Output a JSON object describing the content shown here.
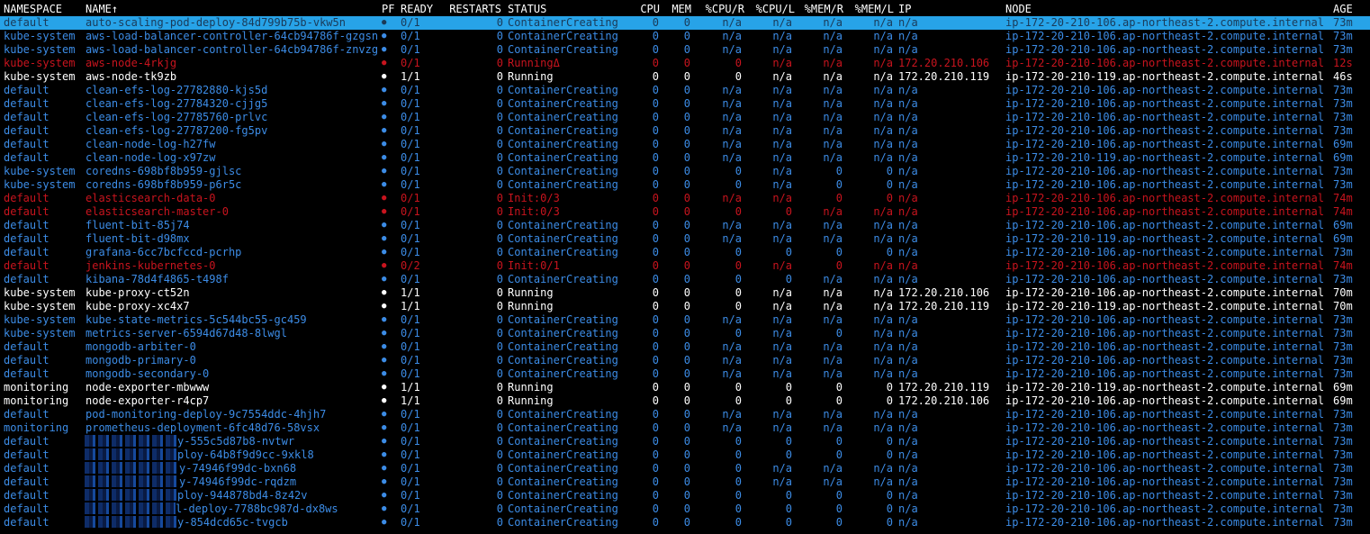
{
  "colors": {
    "running": "#ffffff",
    "pending": "#3c8ce6",
    "error": "#c8141e",
    "selected_bg": "#27a3e8",
    "background": "#000000"
  },
  "header": {
    "namespace": "NAMESPACE",
    "name": "NAME↑",
    "pf": "PF",
    "ready": "READY",
    "restarts": "RESTARTS",
    "status": "STATUS",
    "cpu": "CPU",
    "mem": "MEM",
    "cpu_r": "%CPU/R",
    "cpu_l": "%CPU/L",
    "mem_r": "%MEM/R",
    "mem_l": "%MEM/L",
    "ip": "IP",
    "node": "NODE",
    "age": "AGE"
  },
  "rows": [
    {
      "state": "selected",
      "masked": false,
      "namespace": "default",
      "name": "auto-scaling-pod-deploy-84d799b75b-vkw5n",
      "pf": "●",
      "ready": "0/1",
      "restarts": "0",
      "status": "ContainerCreating",
      "cpu": "0",
      "mem": "0",
      "cpu_r": "n/a",
      "cpu_l": "n/a",
      "mem_r": "n/a",
      "mem_l": "n/a",
      "ip": "n/a",
      "node": "ip-172-20-210-106.ap-northeast-2.compute.internal",
      "age": "73m"
    },
    {
      "state": "pending",
      "masked": false,
      "namespace": "kube-system",
      "name": "aws-load-balancer-controller-64cb94786f-gzgsn",
      "pf": "●",
      "ready": "0/1",
      "restarts": "0",
      "status": "ContainerCreating",
      "cpu": "0",
      "mem": "0",
      "cpu_r": "n/a",
      "cpu_l": "n/a",
      "mem_r": "n/a",
      "mem_l": "n/a",
      "ip": "n/a",
      "node": "ip-172-20-210-106.ap-northeast-2.compute.internal",
      "age": "73m"
    },
    {
      "state": "pending",
      "masked": false,
      "namespace": "kube-system",
      "name": "aws-load-balancer-controller-64cb94786f-znvzg",
      "pf": "●",
      "ready": "0/1",
      "restarts": "0",
      "status": "ContainerCreating",
      "cpu": "0",
      "mem": "0",
      "cpu_r": "n/a",
      "cpu_l": "n/a",
      "mem_r": "n/a",
      "mem_l": "n/a",
      "ip": "n/a",
      "node": "ip-172-20-210-106.ap-northeast-2.compute.internal",
      "age": "73m"
    },
    {
      "state": "error",
      "masked": false,
      "namespace": "kube-system",
      "name": "aws-node-4rkjg",
      "pf": "●",
      "ready": "0/1",
      "restarts": "0",
      "status": "RunningΔ",
      "cpu": "0",
      "mem": "0",
      "cpu_r": "0",
      "cpu_l": "n/a",
      "mem_r": "n/a",
      "mem_l": "n/a",
      "ip": "172.20.210.106",
      "node": "ip-172-20-210-106.ap-northeast-2.compute.internal",
      "age": "12s"
    },
    {
      "state": "running",
      "masked": false,
      "namespace": "kube-system",
      "name": "aws-node-tk9zb",
      "pf": "●",
      "ready": "1/1",
      "restarts": "0",
      "status": "Running",
      "cpu": "0",
      "mem": "0",
      "cpu_r": "0",
      "cpu_l": "n/a",
      "mem_r": "n/a",
      "mem_l": "n/a",
      "ip": "172.20.210.119",
      "node": "ip-172-20-210-119.ap-northeast-2.compute.internal",
      "age": "46s"
    },
    {
      "state": "pending",
      "masked": false,
      "namespace": "default",
      "name": "clean-efs-log-27782880-kjs5d",
      "pf": "●",
      "ready": "0/1",
      "restarts": "0",
      "status": "ContainerCreating",
      "cpu": "0",
      "mem": "0",
      "cpu_r": "n/a",
      "cpu_l": "n/a",
      "mem_r": "n/a",
      "mem_l": "n/a",
      "ip": "n/a",
      "node": "ip-172-20-210-106.ap-northeast-2.compute.internal",
      "age": "73m"
    },
    {
      "state": "pending",
      "masked": false,
      "namespace": "default",
      "name": "clean-efs-log-27784320-cjjg5",
      "pf": "●",
      "ready": "0/1",
      "restarts": "0",
      "status": "ContainerCreating",
      "cpu": "0",
      "mem": "0",
      "cpu_r": "n/a",
      "cpu_l": "n/a",
      "mem_r": "n/a",
      "mem_l": "n/a",
      "ip": "n/a",
      "node": "ip-172-20-210-106.ap-northeast-2.compute.internal",
      "age": "73m"
    },
    {
      "state": "pending",
      "masked": false,
      "namespace": "default",
      "name": "clean-efs-log-27785760-prlvc",
      "pf": "●",
      "ready": "0/1",
      "restarts": "0",
      "status": "ContainerCreating",
      "cpu": "0",
      "mem": "0",
      "cpu_r": "n/a",
      "cpu_l": "n/a",
      "mem_r": "n/a",
      "mem_l": "n/a",
      "ip": "n/a",
      "node": "ip-172-20-210-106.ap-northeast-2.compute.internal",
      "age": "73m"
    },
    {
      "state": "pending",
      "masked": false,
      "namespace": "default",
      "name": "clean-efs-log-27787200-fg5pv",
      "pf": "●",
      "ready": "0/1",
      "restarts": "0",
      "status": "ContainerCreating",
      "cpu": "0",
      "mem": "0",
      "cpu_r": "n/a",
      "cpu_l": "n/a",
      "mem_r": "n/a",
      "mem_l": "n/a",
      "ip": "n/a",
      "node": "ip-172-20-210-106.ap-northeast-2.compute.internal",
      "age": "73m"
    },
    {
      "state": "pending",
      "masked": false,
      "namespace": "default",
      "name": "clean-node-log-h27fw",
      "pf": "●",
      "ready": "0/1",
      "restarts": "0",
      "status": "ContainerCreating",
      "cpu": "0",
      "mem": "0",
      "cpu_r": "n/a",
      "cpu_l": "n/a",
      "mem_r": "n/a",
      "mem_l": "n/a",
      "ip": "n/a",
      "node": "ip-172-20-210-106.ap-northeast-2.compute.internal",
      "age": "69m"
    },
    {
      "state": "pending",
      "masked": false,
      "namespace": "default",
      "name": "clean-node-log-x97zw",
      "pf": "●",
      "ready": "0/1",
      "restarts": "0",
      "status": "ContainerCreating",
      "cpu": "0",
      "mem": "0",
      "cpu_r": "n/a",
      "cpu_l": "n/a",
      "mem_r": "n/a",
      "mem_l": "n/a",
      "ip": "n/a",
      "node": "ip-172-20-210-119.ap-northeast-2.compute.internal",
      "age": "69m"
    },
    {
      "state": "pending",
      "masked": false,
      "namespace": "kube-system",
      "name": "coredns-698bf8b959-gjlsc",
      "pf": "●",
      "ready": "0/1",
      "restarts": "0",
      "status": "ContainerCreating",
      "cpu": "0",
      "mem": "0",
      "cpu_r": "0",
      "cpu_l": "n/a",
      "mem_r": "0",
      "mem_l": "0",
      "ip": "n/a",
      "node": "ip-172-20-210-106.ap-northeast-2.compute.internal",
      "age": "73m"
    },
    {
      "state": "pending",
      "masked": false,
      "namespace": "kube-system",
      "name": "coredns-698bf8b959-p6r5c",
      "pf": "●",
      "ready": "0/1",
      "restarts": "0",
      "status": "ContainerCreating",
      "cpu": "0",
      "mem": "0",
      "cpu_r": "0",
      "cpu_l": "n/a",
      "mem_r": "0",
      "mem_l": "0",
      "ip": "n/a",
      "node": "ip-172-20-210-106.ap-northeast-2.compute.internal",
      "age": "73m"
    },
    {
      "state": "error",
      "masked": false,
      "namespace": "default",
      "name": "elasticsearch-data-0",
      "pf": "●",
      "ready": "0/1",
      "restarts": "0",
      "status": "Init:0/3",
      "cpu": "0",
      "mem": "0",
      "cpu_r": "n/a",
      "cpu_l": "n/a",
      "mem_r": "0",
      "mem_l": "0",
      "ip": "n/a",
      "node": "ip-172-20-210-106.ap-northeast-2.compute.internal",
      "age": "74m"
    },
    {
      "state": "error",
      "masked": false,
      "namespace": "default",
      "name": "elasticsearch-master-0",
      "pf": "●",
      "ready": "0/1",
      "restarts": "0",
      "status": "Init:0/3",
      "cpu": "0",
      "mem": "0",
      "cpu_r": "0",
      "cpu_l": "0",
      "mem_r": "n/a",
      "mem_l": "n/a",
      "ip": "n/a",
      "node": "ip-172-20-210-106.ap-northeast-2.compute.internal",
      "age": "74m"
    },
    {
      "state": "pending",
      "masked": false,
      "namespace": "default",
      "name": "fluent-bit-85j74",
      "pf": "●",
      "ready": "0/1",
      "restarts": "0",
      "status": "ContainerCreating",
      "cpu": "0",
      "mem": "0",
      "cpu_r": "n/a",
      "cpu_l": "n/a",
      "mem_r": "n/a",
      "mem_l": "n/a",
      "ip": "n/a",
      "node": "ip-172-20-210-106.ap-northeast-2.compute.internal",
      "age": "69m"
    },
    {
      "state": "pending",
      "masked": false,
      "namespace": "default",
      "name": "fluent-bit-d98mx",
      "pf": "●",
      "ready": "0/1",
      "restarts": "0",
      "status": "ContainerCreating",
      "cpu": "0",
      "mem": "0",
      "cpu_r": "n/a",
      "cpu_l": "n/a",
      "mem_r": "n/a",
      "mem_l": "n/a",
      "ip": "n/a",
      "node": "ip-172-20-210-119.ap-northeast-2.compute.internal",
      "age": "69m"
    },
    {
      "state": "pending",
      "masked": false,
      "namespace": "default",
      "name": "grafana-6cc7bcfccd-pcrhp",
      "pf": "●",
      "ready": "0/1",
      "restarts": "0",
      "status": "ContainerCreating",
      "cpu": "0",
      "mem": "0",
      "cpu_r": "0",
      "cpu_l": "0",
      "mem_r": "0",
      "mem_l": "0",
      "ip": "n/a",
      "node": "ip-172-20-210-106.ap-northeast-2.compute.internal",
      "age": "73m"
    },
    {
      "state": "error",
      "masked": false,
      "namespace": "default",
      "name": "jenkins-kubernetes-0",
      "pf": "●",
      "ready": "0/2",
      "restarts": "0",
      "status": "Init:0/1",
      "cpu": "0",
      "mem": "0",
      "cpu_r": "0",
      "cpu_l": "n/a",
      "mem_r": "0",
      "mem_l": "n/a",
      "ip": "n/a",
      "node": "ip-172-20-210-106.ap-northeast-2.compute.internal",
      "age": "74m"
    },
    {
      "state": "pending",
      "masked": false,
      "namespace": "default",
      "name": "kibana-78d4f4865-t498f",
      "pf": "●",
      "ready": "0/1",
      "restarts": "0",
      "status": "ContainerCreating",
      "cpu": "0",
      "mem": "0",
      "cpu_r": "0",
      "cpu_l": "0",
      "mem_r": "n/a",
      "mem_l": "n/a",
      "ip": "n/a",
      "node": "ip-172-20-210-106.ap-northeast-2.compute.internal",
      "age": "73m"
    },
    {
      "state": "running",
      "masked": false,
      "namespace": "kube-system",
      "name": "kube-proxy-ct52n",
      "pf": "●",
      "ready": "1/1",
      "restarts": "0",
      "status": "Running",
      "cpu": "0",
      "mem": "0",
      "cpu_r": "0",
      "cpu_l": "n/a",
      "mem_r": "n/a",
      "mem_l": "n/a",
      "ip": "172.20.210.106",
      "node": "ip-172-20-210-106.ap-northeast-2.compute.internal",
      "age": "70m"
    },
    {
      "state": "running",
      "masked": false,
      "namespace": "kube-system",
      "name": "kube-proxy-xc4x7",
      "pf": "●",
      "ready": "1/1",
      "restarts": "0",
      "status": "Running",
      "cpu": "0",
      "mem": "0",
      "cpu_r": "0",
      "cpu_l": "n/a",
      "mem_r": "n/a",
      "mem_l": "n/a",
      "ip": "172.20.210.119",
      "node": "ip-172-20-210-119.ap-northeast-2.compute.internal",
      "age": "70m"
    },
    {
      "state": "pending",
      "masked": false,
      "namespace": "kube-system",
      "name": "kube-state-metrics-5c544bc55-gc459",
      "pf": "●",
      "ready": "0/1",
      "restarts": "0",
      "status": "ContainerCreating",
      "cpu": "0",
      "mem": "0",
      "cpu_r": "n/a",
      "cpu_l": "n/a",
      "mem_r": "n/a",
      "mem_l": "n/a",
      "ip": "n/a",
      "node": "ip-172-20-210-106.ap-northeast-2.compute.internal",
      "age": "73m"
    },
    {
      "state": "pending",
      "masked": false,
      "namespace": "kube-system",
      "name": "metrics-server-6594d67d48-8lwgl",
      "pf": "●",
      "ready": "0/1",
      "restarts": "0",
      "status": "ContainerCreating",
      "cpu": "0",
      "mem": "0",
      "cpu_r": "0",
      "cpu_l": "n/a",
      "mem_r": "0",
      "mem_l": "n/a",
      "ip": "n/a",
      "node": "ip-172-20-210-106.ap-northeast-2.compute.internal",
      "age": "73m"
    },
    {
      "state": "pending",
      "masked": false,
      "namespace": "default",
      "name": "mongodb-arbiter-0",
      "pf": "●",
      "ready": "0/1",
      "restarts": "0",
      "status": "ContainerCreating",
      "cpu": "0",
      "mem": "0",
      "cpu_r": "n/a",
      "cpu_l": "n/a",
      "mem_r": "n/a",
      "mem_l": "n/a",
      "ip": "n/a",
      "node": "ip-172-20-210-106.ap-northeast-2.compute.internal",
      "age": "73m"
    },
    {
      "state": "pending",
      "masked": false,
      "namespace": "default",
      "name": "mongodb-primary-0",
      "pf": "●",
      "ready": "0/1",
      "restarts": "0",
      "status": "ContainerCreating",
      "cpu": "0",
      "mem": "0",
      "cpu_r": "n/a",
      "cpu_l": "n/a",
      "mem_r": "n/a",
      "mem_l": "n/a",
      "ip": "n/a",
      "node": "ip-172-20-210-106.ap-northeast-2.compute.internal",
      "age": "73m"
    },
    {
      "state": "pending",
      "masked": false,
      "namespace": "default",
      "name": "mongodb-secondary-0",
      "pf": "●",
      "ready": "0/1",
      "restarts": "0",
      "status": "ContainerCreating",
      "cpu": "0",
      "mem": "0",
      "cpu_r": "n/a",
      "cpu_l": "n/a",
      "mem_r": "n/a",
      "mem_l": "n/a",
      "ip": "n/a",
      "node": "ip-172-20-210-106.ap-northeast-2.compute.internal",
      "age": "73m"
    },
    {
      "state": "running",
      "masked": false,
      "namespace": "monitoring",
      "name": "node-exporter-mbwww",
      "pf": "●",
      "ready": "1/1",
      "restarts": "0",
      "status": "Running",
      "cpu": "0",
      "mem": "0",
      "cpu_r": "0",
      "cpu_l": "0",
      "mem_r": "0",
      "mem_l": "0",
      "ip": "172.20.210.119",
      "node": "ip-172-20-210-119.ap-northeast-2.compute.internal",
      "age": "69m"
    },
    {
      "state": "running",
      "masked": false,
      "namespace": "monitoring",
      "name": "node-exporter-r4cp7",
      "pf": "●",
      "ready": "1/1",
      "restarts": "0",
      "status": "Running",
      "cpu": "0",
      "mem": "0",
      "cpu_r": "0",
      "cpu_l": "0",
      "mem_r": "0",
      "mem_l": "0",
      "ip": "172.20.210.106",
      "node": "ip-172-20-210-106.ap-northeast-2.compute.internal",
      "age": "69m"
    },
    {
      "state": "pending",
      "masked": false,
      "namespace": "default",
      "name": "pod-monitoring-deploy-9c7554ddc-4hjh7",
      "pf": "●",
      "ready": "0/1",
      "restarts": "0",
      "status": "ContainerCreating",
      "cpu": "0",
      "mem": "0",
      "cpu_r": "n/a",
      "cpu_l": "n/a",
      "mem_r": "n/a",
      "mem_l": "n/a",
      "ip": "n/a",
      "node": "ip-172-20-210-106.ap-northeast-2.compute.internal",
      "age": "73m"
    },
    {
      "state": "pending",
      "masked": false,
      "namespace": "monitoring",
      "name": "prometheus-deployment-6fc48d76-58vsx",
      "pf": "●",
      "ready": "0/1",
      "restarts": "0",
      "status": "ContainerCreating",
      "cpu": "0",
      "mem": "0",
      "cpu_r": "n/a",
      "cpu_l": "n/a",
      "mem_r": "n/a",
      "mem_l": "n/a",
      "ip": "n/a",
      "node": "ip-172-20-210-106.ap-northeast-2.compute.internal",
      "age": "73m"
    },
    {
      "state": "pending",
      "masked": true,
      "namespace": "default",
      "name": "y-555c5d87b8-nvtwr",
      "pf": "●",
      "ready": "0/1",
      "restarts": "0",
      "status": "ContainerCreating",
      "cpu": "0",
      "mem": "0",
      "cpu_r": "0",
      "cpu_l": "0",
      "mem_r": "0",
      "mem_l": "0",
      "ip": "n/a",
      "node": "ip-172-20-210-106.ap-northeast-2.compute.internal",
      "age": "73m"
    },
    {
      "state": "pending",
      "masked": true,
      "namespace": "default",
      "name": "ploy-64b8f9d9cc-9xkl8",
      "pf": "●",
      "ready": "0/1",
      "restarts": "0",
      "status": "ContainerCreating",
      "cpu": "0",
      "mem": "0",
      "cpu_r": "0",
      "cpu_l": "0",
      "mem_r": "0",
      "mem_l": "0",
      "ip": "n/a",
      "node": "ip-172-20-210-106.ap-northeast-2.compute.internal",
      "age": "73m"
    },
    {
      "state": "pending",
      "masked": true,
      "namespace": "default",
      "name": "y-74946f99dc-bxn68",
      "pf": "●",
      "ready": "0/1",
      "restarts": "0",
      "status": "ContainerCreating",
      "cpu": "0",
      "mem": "0",
      "cpu_r": "0",
      "cpu_l": "n/a",
      "mem_r": "n/a",
      "mem_l": "n/a",
      "ip": "n/a",
      "node": "ip-172-20-210-106.ap-northeast-2.compute.internal",
      "age": "73m"
    },
    {
      "state": "pending",
      "masked": true,
      "namespace": "default",
      "name": "y-74946f99dc-rqdzm",
      "pf": "●",
      "ready": "0/1",
      "restarts": "0",
      "status": "ContainerCreating",
      "cpu": "0",
      "mem": "0",
      "cpu_r": "0",
      "cpu_l": "n/a",
      "mem_r": "n/a",
      "mem_l": "n/a",
      "ip": "n/a",
      "node": "ip-172-20-210-106.ap-northeast-2.compute.internal",
      "age": "73m"
    },
    {
      "state": "pending",
      "masked": true,
      "namespace": "default",
      "name": "ploy-944878bd4-8z42v",
      "pf": "●",
      "ready": "0/1",
      "restarts": "0",
      "status": "ContainerCreating",
      "cpu": "0",
      "mem": "0",
      "cpu_r": "0",
      "cpu_l": "0",
      "mem_r": "0",
      "mem_l": "0",
      "ip": "n/a",
      "node": "ip-172-20-210-106.ap-northeast-2.compute.internal",
      "age": "73m"
    },
    {
      "state": "pending",
      "masked": true,
      "namespace": "default",
      "name": "l-deploy-7788bc987d-dx8ws",
      "pf": "●",
      "ready": "0/1",
      "restarts": "0",
      "status": "ContainerCreating",
      "cpu": "0",
      "mem": "0",
      "cpu_r": "0",
      "cpu_l": "0",
      "mem_r": "0",
      "mem_l": "0",
      "ip": "n/a",
      "node": "ip-172-20-210-106.ap-northeast-2.compute.internal",
      "age": "73m"
    },
    {
      "state": "pending",
      "masked": true,
      "namespace": "default",
      "name": "y-854dcd65c-tvgcb",
      "pf": "●",
      "ready": "0/1",
      "restarts": "0",
      "status": "ContainerCreating",
      "cpu": "0",
      "mem": "0",
      "cpu_r": "0",
      "cpu_l": "0",
      "mem_r": "0",
      "mem_l": "0",
      "ip": "n/a",
      "node": "ip-172-20-210-106.ap-northeast-2.compute.internal",
      "age": "73m"
    }
  ]
}
